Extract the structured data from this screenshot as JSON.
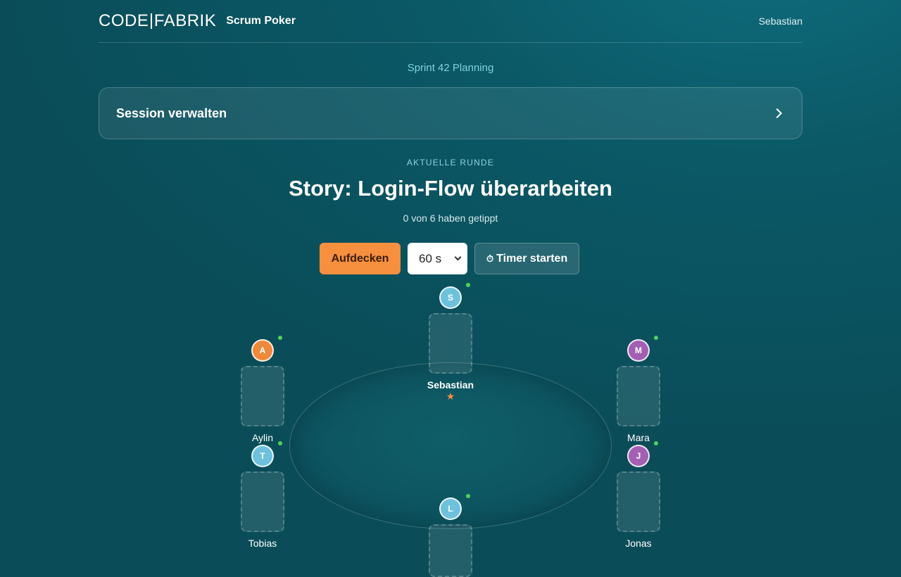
{
  "header": {
    "logo_left": "CODE",
    "logo_right": "FABRIK",
    "app_name": "Scrum Poker",
    "user_name": "Sebastian"
  },
  "session": {
    "title": "Sprint 42 Planning",
    "manage_label": "Session verwalten"
  },
  "round": {
    "label": "AKTUELLE RUNDE",
    "story": "Story: Login-Flow überarbeiten",
    "progress": "0 von 6 haben getippt"
  },
  "controls": {
    "reveal_label": "Aufdecken",
    "timer_select_value": "60 s",
    "timer_start_label": "Timer starten",
    "timer_icon": "⏱"
  },
  "players": [
    {
      "initial": "S",
      "name": "Sebastian",
      "color": "#6ec1dc",
      "is_me": true,
      "online": true
    },
    {
      "initial": "A",
      "name": "Aylin",
      "color": "#f0883a",
      "is_me": false,
      "online": true
    },
    {
      "initial": "M",
      "name": "Mara",
      "color": "#a35fb3",
      "is_me": false,
      "online": true
    },
    {
      "initial": "T",
      "name": "Tobias",
      "color": "#6ec1dc",
      "is_me": false,
      "online": true
    },
    {
      "initial": "J",
      "name": "Jonas",
      "color": "#a35fb3",
      "is_me": false,
      "online": true
    },
    {
      "initial": "L",
      "name": "",
      "color": "#6ec1dc",
      "is_me": false,
      "online": true
    }
  ],
  "icons": {
    "host_star": "★",
    "online_status": "online-dot-icon",
    "panel_expand": "chevron-right-icon"
  },
  "colors": {
    "accent": "#f68f3e",
    "online": "#4fd15e",
    "title_teal": "#7fd3de"
  }
}
